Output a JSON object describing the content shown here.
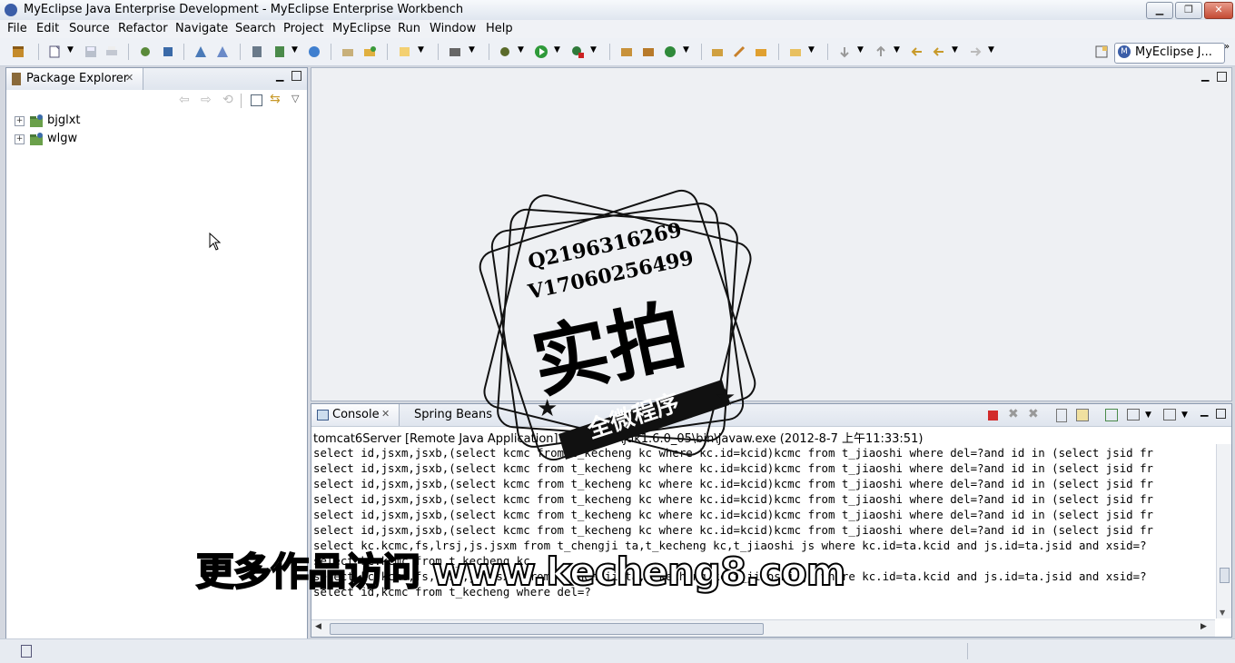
{
  "window": {
    "title": "MyEclipse Java Enterprise Development - MyEclipse Enterprise Workbench"
  },
  "menu": [
    "File",
    "Edit",
    "Source",
    "Refactor",
    "Navigate",
    "Search",
    "Project",
    "MyEclipse",
    "Run",
    "Window",
    "Help"
  ],
  "perspective": {
    "label": "MyEclipse J..."
  },
  "package_explorer": {
    "tab_label": "Package Explorer",
    "projects": [
      {
        "name": "bjglxt"
      },
      {
        "name": "wlgw"
      }
    ]
  },
  "console": {
    "tab_label": "Console",
    "tab2_label": "Spring Beans",
    "description": "tomcat6Server [Remote Java Application] C:\\Prog... \\jdk1.6.0_05\\bin\\javaw.exe (2012-8-7 上午11:33:51)",
    "lines": [
      "select id,jsxm,jsxb,(select kcmc from t_kecheng kc where kc.id=kcid)kcmc from t_jiaoshi where del=?and id in (select jsid fr",
      "select id,jsxm,jsxb,(select kcmc from t_kecheng kc where kc.id=kcid)kcmc from t_jiaoshi where del=?and id in (select jsid fr",
      "select id,jsxm,jsxb,(select kcmc from t_kecheng kc where kc.id=kcid)kcmc from t_jiaoshi where del=?and id in (select jsid fr",
      "select id,jsxm,jsxb,(select kcmc from t_kecheng kc where kc.id=kcid)kcmc from t_jiaoshi where del=?and id in (select jsid fr",
      "select id,jsxm,jsxb,(select kcmc from t_kecheng kc where kc.id=kcid)kcmc from t_jiaoshi where del=?and id in (select jsid fr",
      "select id,jsxm,jsxb,(select kcmc from t_kecheng kc where kc.id=kcid)kcmc from t_jiaoshi where del=?and id in (select jsid fr",
      "select kc.kcmc,fs,lrsj,js.jsxm from t_chengji ta,t_kecheng kc,t_jiaoshi js where kc.id=ta.kcid and js.id=ta.jsid and xsid=?",
      "select kc.kcmc from t_kecheng kc",
      "select kc.kcmc,fs,lrsj,js.jsxm from t_chengji ta,t_kecheng kc,t_jiaoshi js where kc.id=ta.kcid and js.id=ta.jsid and xsid=?",
      "select id,kcmc from t_kecheng where del=?"
    ]
  },
  "watermark": {
    "line1": "Q2196316269",
    "line2": "V17060256499",
    "big": "实拍",
    "ribbon": "全微程序",
    "bottom": "更多作品访问 www.kecheng8.com"
  },
  "colors": {
    "accent": "#3b5ea8",
    "stop_red": "#d22b2b"
  }
}
